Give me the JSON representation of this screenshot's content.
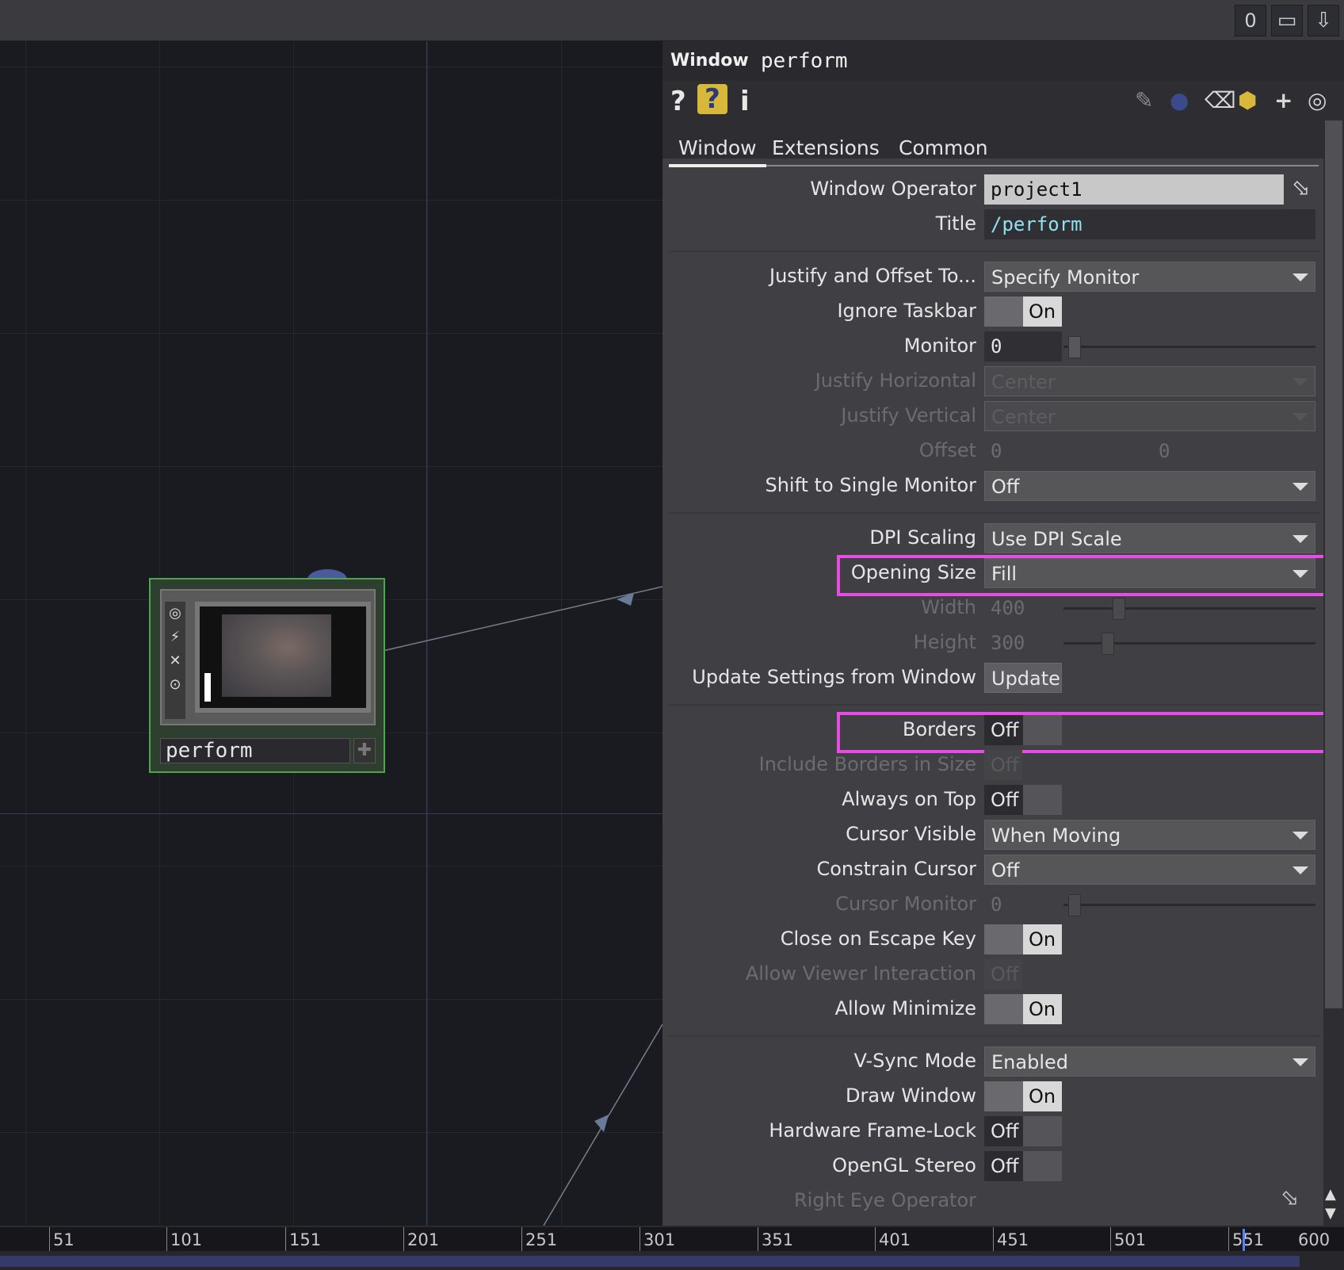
{
  "topbar": {
    "counter": "0"
  },
  "node": {
    "name": "perform"
  },
  "panel": {
    "op_type": "Window",
    "op_name": "perform",
    "tabs": [
      "Window",
      "Extensions",
      "Common"
    ],
    "params": {
      "window_operator": {
        "label": "Window Operator",
        "value": "project1"
      },
      "title": {
        "label": "Title",
        "value": "/perform"
      },
      "justify_offset": {
        "label": "Justify and Offset To...",
        "value": "Specify Monitor"
      },
      "ignore_taskbar": {
        "label": "Ignore Taskbar",
        "value": "On"
      },
      "monitor": {
        "label": "Monitor",
        "value": "0"
      },
      "justify_h": {
        "label": "Justify Horizontal",
        "value": "Center"
      },
      "justify_v": {
        "label": "Justify Vertical",
        "value": "Center"
      },
      "offset": {
        "label": "Offset",
        "value1": "0",
        "value2": "0"
      },
      "shift_single": {
        "label": "Shift to Single Monitor",
        "value": "Off"
      },
      "dpi_scaling": {
        "label": "DPI Scaling",
        "value": "Use DPI Scale"
      },
      "opening_size": {
        "label": "Opening Size",
        "value": "Fill"
      },
      "width": {
        "label": "Width",
        "value": "400"
      },
      "height": {
        "label": "Height",
        "value": "300"
      },
      "update_settings": {
        "label": "Update Settings from Window",
        "value": "Update"
      },
      "borders": {
        "label": "Borders",
        "value": "Off"
      },
      "include_borders": {
        "label": "Include Borders in Size",
        "value": "Off"
      },
      "always_on_top": {
        "label": "Always on Top",
        "value": "Off"
      },
      "cursor_visible": {
        "label": "Cursor Visible",
        "value": "When Moving"
      },
      "constrain_cursor": {
        "label": "Constrain Cursor",
        "value": "Off"
      },
      "cursor_monitor": {
        "label": "Cursor Monitor",
        "value": "0"
      },
      "close_escape": {
        "label": "Close on Escape Key",
        "value": "On"
      },
      "allow_viewer": {
        "label": "Allow Viewer Interaction",
        "value": "Off"
      },
      "allow_minimize": {
        "label": "Allow Minimize",
        "value": "On"
      },
      "vsync": {
        "label": "V-Sync Mode",
        "value": "Enabled"
      },
      "draw_window": {
        "label": "Draw Window",
        "value": "On"
      },
      "hw_framelock": {
        "label": "Hardware Frame-Lock",
        "value": "Off"
      },
      "opengl_stereo": {
        "label": "OpenGL Stereo",
        "value": "Off"
      },
      "right_eye": {
        "label": "Right Eye Operator"
      }
    }
  },
  "timeline": {
    "ticks": [
      "51",
      "101",
      "151",
      "201",
      "251",
      "301",
      "351",
      "401",
      "451",
      "501",
      "551",
      "600"
    ]
  },
  "colors": {
    "highlight": "#e84be8",
    "node_border": "#4aa84a",
    "accent": "#5a7cff"
  }
}
